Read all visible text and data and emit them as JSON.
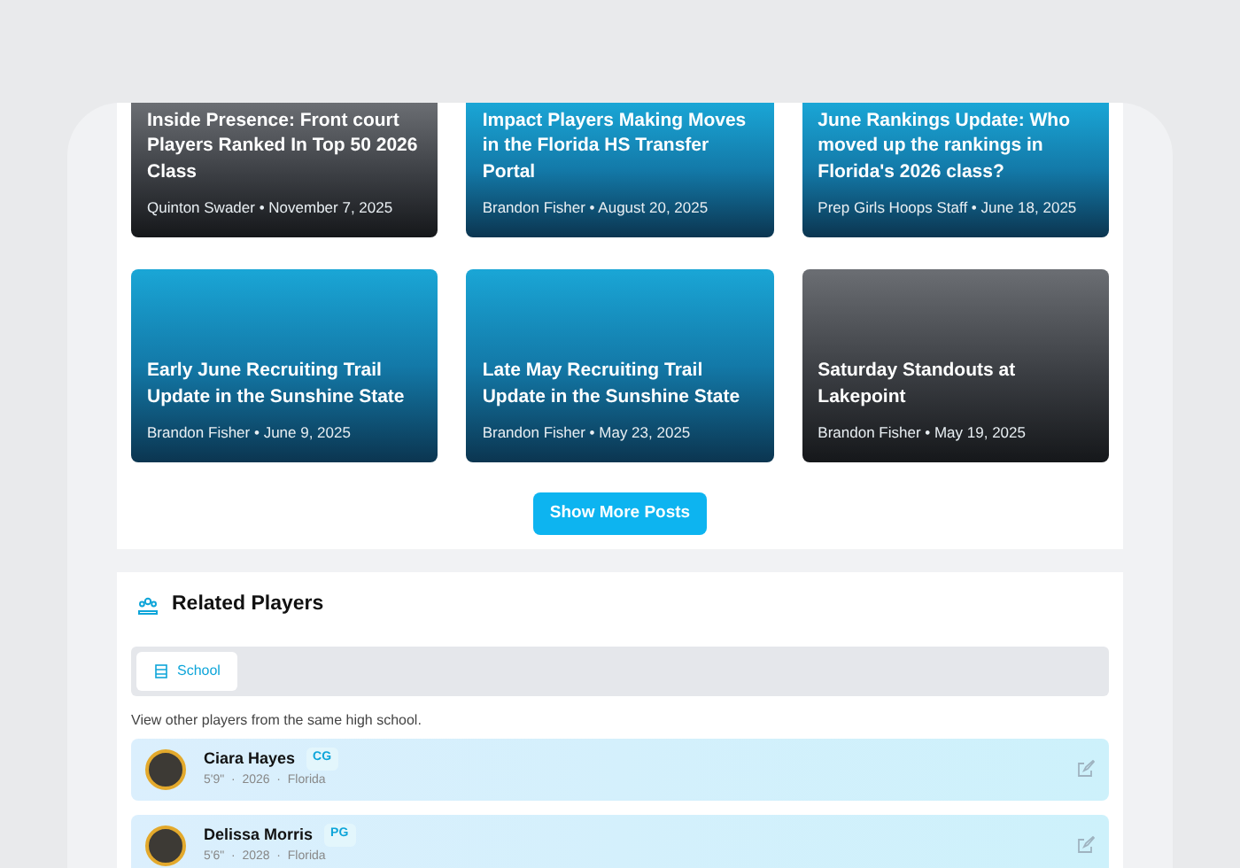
{
  "posts": [
    {
      "title": "Inside Presence: Front court Players Ranked In Top 50 2026 Class",
      "meta": "Quinton Swader • November 7, 2025",
      "kind": "photo"
    },
    {
      "title": "Impact Players Making Moves in the Florida HS Transfer Portal",
      "meta": "Brandon Fisher • August 20, 2025",
      "kind": "graphic"
    },
    {
      "title": "June Rankings Update: Who moved up the rankings in Florida's 2026 class?",
      "meta": "Prep Girls Hoops Staff • June 18, 2025",
      "kind": "graphic"
    },
    {
      "title": "Early June Recruiting Trail Update in the Sunshine State",
      "meta": "Brandon Fisher • June 9, 2025",
      "kind": "graphic"
    },
    {
      "title": "Late May Recruiting Trail Update in the Sunshine State",
      "meta": "Brandon Fisher • May 23, 2025",
      "kind": "graphic"
    },
    {
      "title": "Saturday Standouts at Lakepoint",
      "meta": "Brandon Fisher • May 19, 2025",
      "kind": "photo"
    }
  ],
  "show_more": "Show More Posts",
  "related": {
    "title": "Related Players",
    "tabs": [
      {
        "label": "School",
        "selected": true
      }
    ],
    "description": "View other players from the same high school.",
    "players": [
      {
        "name": "Ciara Hayes",
        "position": "CG",
        "details": "5'9\"  ·  2026  ·  Florida"
      },
      {
        "name": "Delissa Morris",
        "position": "PG",
        "details": "5'6\"  ·  2028  ·  Florida"
      }
    ]
  }
}
